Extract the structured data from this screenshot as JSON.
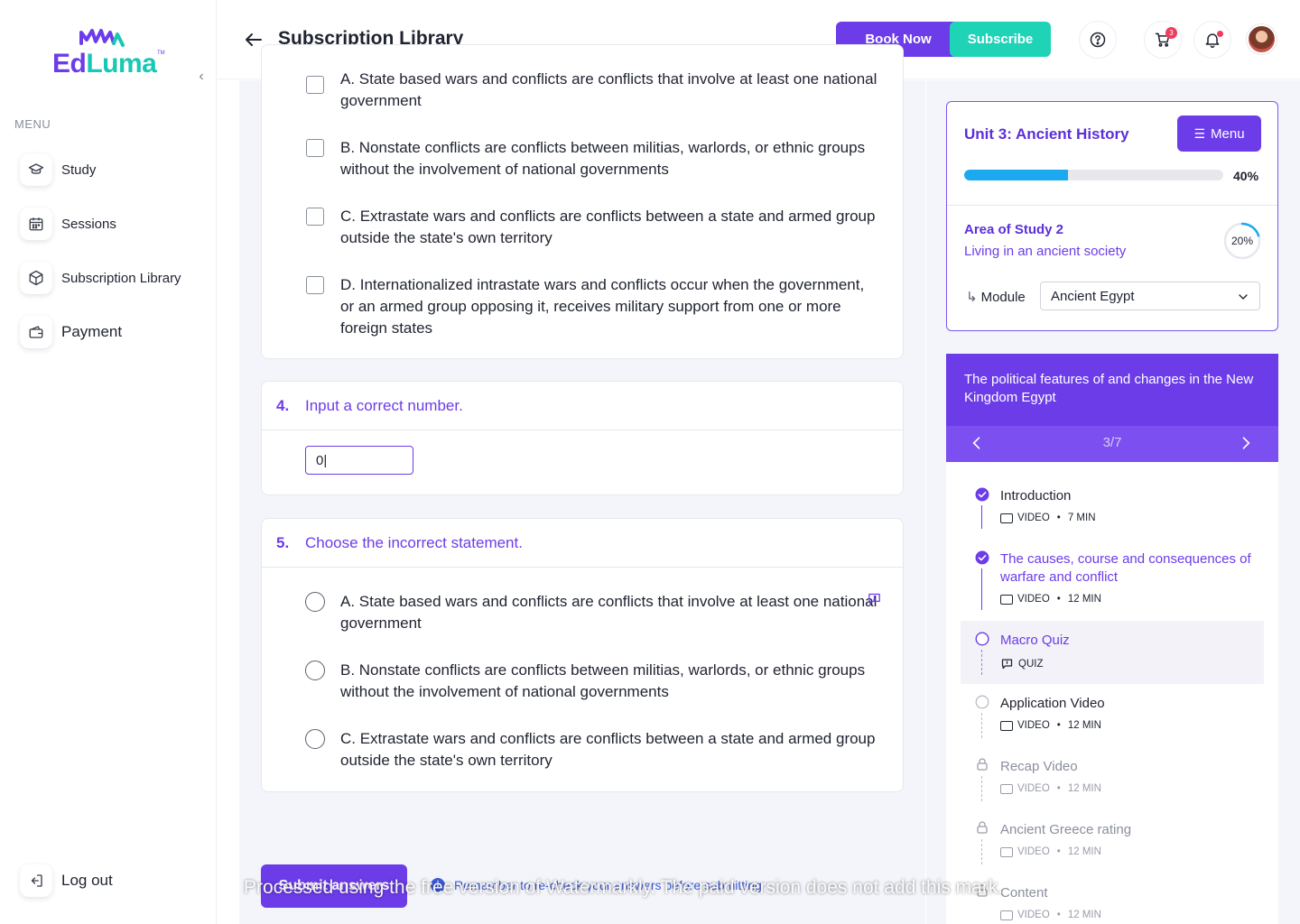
{
  "brand": {
    "name_part1": "Ed",
    "name_part2": "Luma",
    "tm": "TM"
  },
  "sidebar": {
    "menu_heading": "MENU",
    "items": [
      {
        "label": "Study",
        "icon": "graduation-cap-icon"
      },
      {
        "label": "Sessions",
        "icon": "calendar-icon"
      },
      {
        "label": "Subscription Library",
        "icon": "box-icon"
      },
      {
        "label": "Payment",
        "icon": "wallet-icon"
      }
    ],
    "logout_label": "Log out"
  },
  "header": {
    "title": "Subscription Library",
    "book_label": "Book Now",
    "subscribe_label": "Subscribe",
    "cart_count": "3"
  },
  "quiz": {
    "q3_options": [
      "A. State based wars and conflicts are conflicts that involve at least one national government",
      "B. Nonstate conflicts are conflicts between militias, warlords, or ethnic groups without the involvement of national governments",
      "C. Extrastate wars and conflicts are conflicts between a state and armed group outside the state's own territory",
      "D. Internationalized intrastate wars and conflicts occur when the government, or an armed group opposing it, receives military support from one or more foreign states"
    ],
    "q4": {
      "number": "4.",
      "text": "Input a correct number.",
      "value": "0|"
    },
    "q5": {
      "number": "5.",
      "text": "Choose the incorrect statement.",
      "options": [
        "A. State based wars and conflicts are conflicts that involve at least one national government",
        "B. Nonstate conflicts are conflicts between militias, warlords, or ethnic groups without the involvement of national governments",
        "C. Extrastate wars and conflicts are conflicts between a state and armed group outside the state's own territory"
      ]
    },
    "submit_label": "Submit answers",
    "reminder": "Remember to re-check your answers before submitting"
  },
  "unit": {
    "title": "Unit 3: Ancient History",
    "menu_label": "Menu",
    "progress_percent": 40,
    "progress_label": "40%",
    "area_label": "Area of Study 2",
    "area_name": "Living in an ancient society",
    "area_progress_percent": 20,
    "area_progress_label": "20%",
    "module_label": "Module",
    "module_value": "Ancient Egypt"
  },
  "lesson": {
    "title": "The political features of and changes in the New Kingdom Egypt",
    "counter": "3/7",
    "items": [
      {
        "title": "Introduction",
        "type": "VIDEO",
        "duration": "7 MIN",
        "state": "done"
      },
      {
        "title": "The causes, course and consequences of warfare and conflict",
        "type": "VIDEO",
        "duration": "12 MIN",
        "state": "done"
      },
      {
        "title": "Macro Quiz",
        "type": "QUIZ",
        "duration": "",
        "state": "current"
      },
      {
        "title": "Application Video",
        "type": "VIDEO",
        "duration": "12 MIN",
        "state": "todo"
      },
      {
        "title": "Recap Video",
        "type": "VIDEO",
        "duration": "12 MIN",
        "state": "locked"
      },
      {
        "title": "Ancient Greece rating",
        "type": "VIDEO",
        "duration": "12 MIN",
        "state": "locked"
      },
      {
        "title": "Content",
        "type": "VIDEO",
        "duration": "12 MIN",
        "state": "locked"
      }
    ]
  },
  "colors": {
    "primary": "#6c3ce9",
    "teal": "#1fd3b7",
    "progress": "#1ba9f0"
  },
  "watermark_text": "Processed using the free version of Watermarkly. The paid version does not add this mark."
}
